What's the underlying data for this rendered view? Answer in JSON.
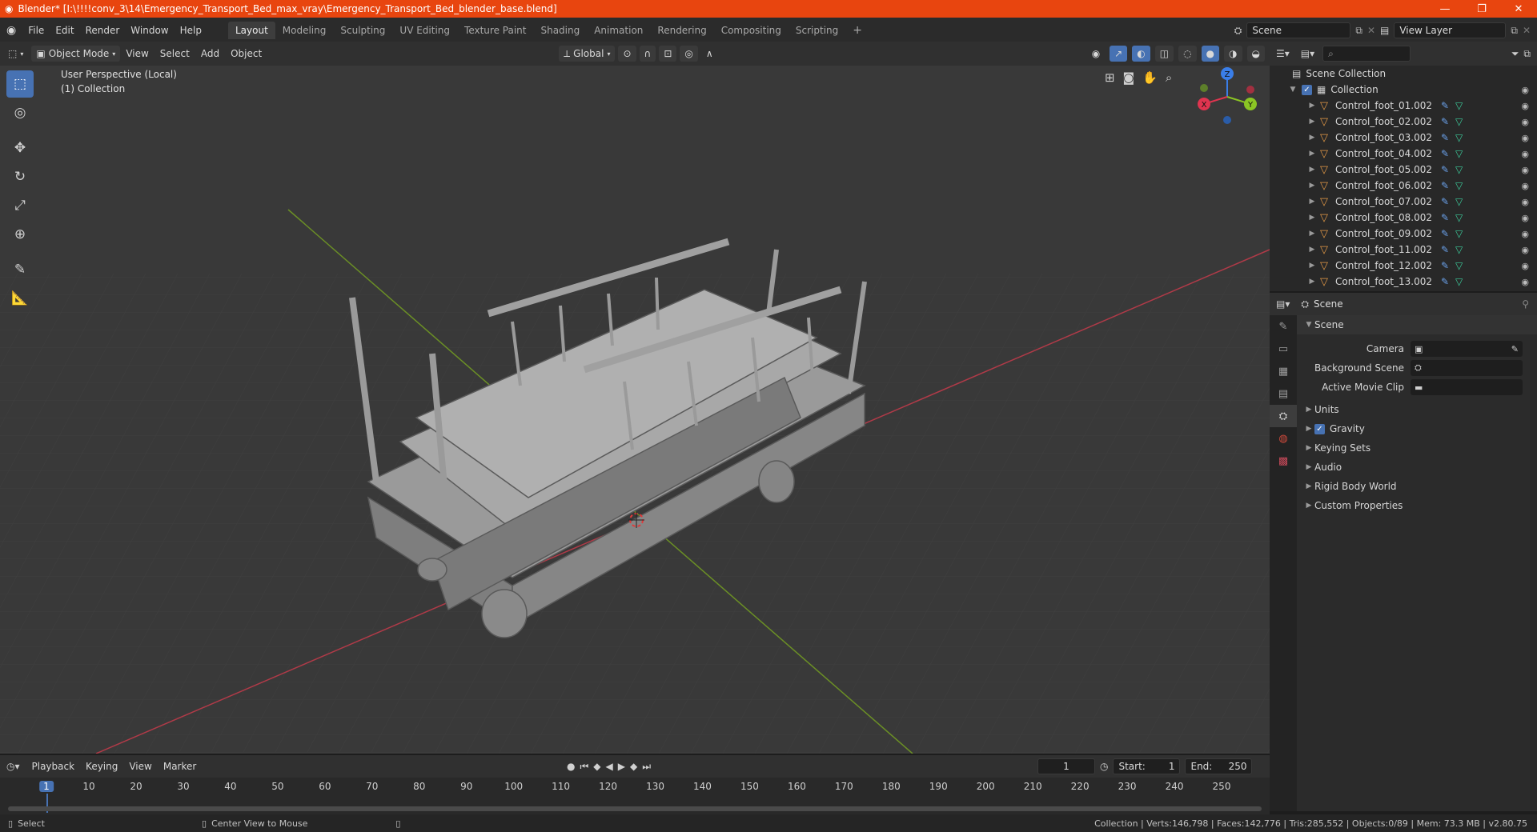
{
  "window": {
    "title": "Blender* [I:\\!!!!conv_3\\14\\Emergency_Transport_Bed_max_vray\\Emergency_Transport_Bed_blender_base.blend]",
    "minimize": "—",
    "maximize": "❐",
    "close": "✕"
  },
  "menus": [
    "File",
    "Edit",
    "Render",
    "Window",
    "Help"
  ],
  "workspaces": [
    "Layout",
    "Modeling",
    "Sculpting",
    "UV Editing",
    "Texture Paint",
    "Shading",
    "Animation",
    "Rendering",
    "Compositing",
    "Scripting"
  ],
  "workspace_add": "+",
  "scene_field": "Scene",
  "view_layer_field": "View Layer",
  "viewport_header": {
    "mode": "Object Mode",
    "menus": [
      "View",
      "Select",
      "Add",
      "Object"
    ],
    "orientation": "Global"
  },
  "viewport": {
    "perspective": "User Perspective (Local)",
    "collection": "(1) Collection"
  },
  "gizmo": {
    "z": "Z",
    "y": "Y",
    "x": "X"
  },
  "outliner": {
    "root": "Scene Collection",
    "collection": "Collection",
    "items": [
      "Control_foot_01.002",
      "Control_foot_02.002",
      "Control_foot_03.002",
      "Control_foot_04.002",
      "Control_foot_05.002",
      "Control_foot_06.002",
      "Control_foot_07.002",
      "Control_foot_08.002",
      "Control_foot_09.002",
      "Control_foot_11.002",
      "Control_foot_12.002",
      "Control_foot_13.002"
    ]
  },
  "properties": {
    "header_title": "Scene",
    "panel_title": "Scene",
    "camera_label": "Camera",
    "background_scene_label": "Background Scene",
    "active_movie_clip_label": "Active Movie Clip",
    "sections": [
      "Units",
      "Gravity",
      "Keying Sets",
      "Audio",
      "Rigid Body World",
      "Custom Properties"
    ]
  },
  "timeline": {
    "menus": [
      "Playback",
      "Keying",
      "View",
      "Marker"
    ],
    "current_frame": "1",
    "start_label": "Start:",
    "start": "1",
    "end_label": "End:",
    "end": "250",
    "ticks": [
      "1",
      "10",
      "20",
      "30",
      "40",
      "50",
      "60",
      "70",
      "80",
      "90",
      "100",
      "110",
      "120",
      "130",
      "140",
      "150",
      "160",
      "170",
      "180",
      "190",
      "200",
      "210",
      "220",
      "230",
      "240",
      "250"
    ]
  },
  "statusbar": {
    "select": "Select",
    "center_view": "Center View to Mouse",
    "stats": "Collection | Verts:146,798 | Faces:142,776 | Tris:285,552 | Objects:0/89 | Mem: 73.3 MB | v2.80.75"
  },
  "colors": {
    "accent": "#4772b3",
    "titlebar": "#e8450f",
    "x_axis": "#e0344f",
    "y_axis": "#8bc524",
    "z_axis": "#3a7ee8"
  }
}
